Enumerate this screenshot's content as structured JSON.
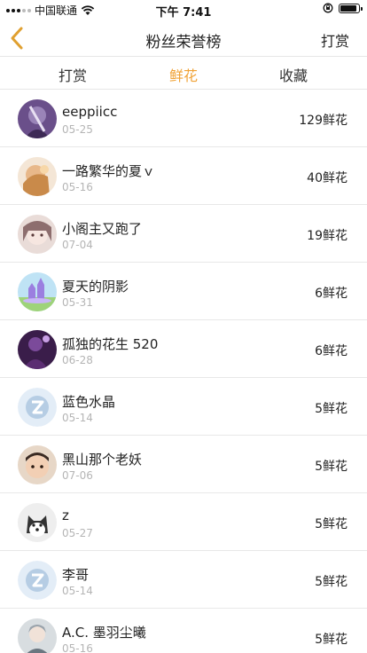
{
  "status": {
    "carrier": "中国联通",
    "time": "下午 7:41"
  },
  "nav": {
    "title": "粉丝荣誉榜",
    "right_label": "打赏"
  },
  "tabs": [
    {
      "label": "打赏"
    },
    {
      "label": "鲜花"
    },
    {
      "label": "收藏"
    }
  ],
  "accent_color": "#f0a236",
  "fans": [
    {
      "name": "eeppiicc",
      "date": "05-25",
      "count": "129鲜花"
    },
    {
      "name": "一路繁华的夏ｖ",
      "date": "05-16",
      "count": "40鲜花"
    },
    {
      "name": "小阁主又跑了",
      "date": "07-04",
      "count": "19鲜花"
    },
    {
      "name": "夏天的阴影",
      "date": "05-31",
      "count": "6鲜花"
    },
    {
      "name": "孤独的花生 520",
      "date": "06-28",
      "count": "6鲜花"
    },
    {
      "name": "蓝色水晶",
      "date": "05-14",
      "count": "5鲜花"
    },
    {
      "name": "黑山那个老妖",
      "date": "07-06",
      "count": "5鲜花"
    },
    {
      "name": "z",
      "date": "05-27",
      "count": "5鲜花"
    },
    {
      "name": "李哥",
      "date": "05-14",
      "count": "5鲜花"
    },
    {
      "name": "A.C. 墨羽尘曦",
      "date": "05-16",
      "count": "5鲜花"
    }
  ]
}
